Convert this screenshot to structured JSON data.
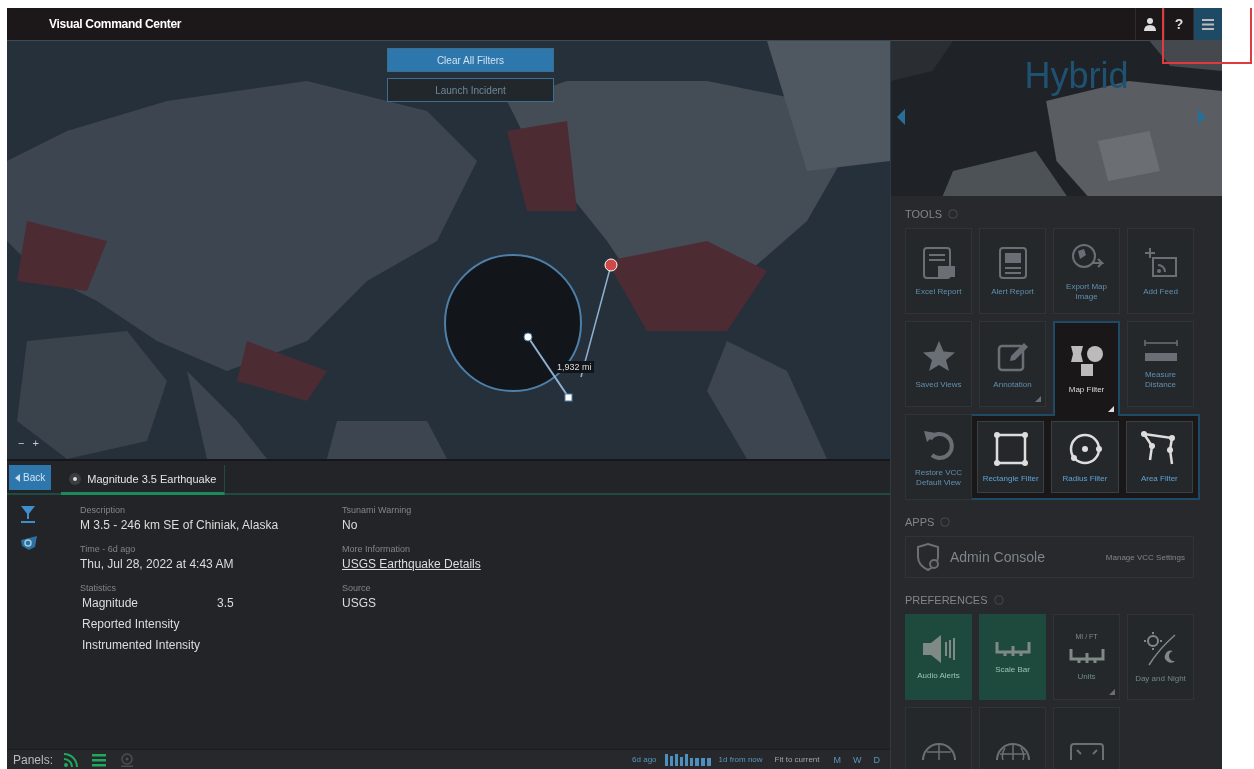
{
  "window": {
    "title": "Visual Command Center"
  },
  "header_buttons": [
    {
      "kind": "user",
      "selected": false
    },
    {
      "kind": "help",
      "label": "?",
      "selected": false
    },
    {
      "kind": "menu",
      "selected": true
    }
  ],
  "highlight_box": true,
  "map": {
    "buttons": [
      {
        "kind": "primary",
        "label": "Clear All Filters"
      },
      {
        "kind": "outline",
        "label": "Launch Incident"
      }
    ],
    "radius_label": "1,932 mi",
    "zoom": [
      {
        "label": "−"
      },
      {
        "label": "+"
      }
    ]
  },
  "detail": {
    "back": "Back",
    "tabs": [
      {
        "label": "Magnitude 3.5 Earthquake",
        "selected": true
      }
    ],
    "columns": [
      [
        {
          "kind": "text",
          "label": "Description",
          "value": "M 3.5 - 246 km SE of Chiniak, Alaska"
        },
        {
          "kind": "text",
          "label": "Time - 6d ago",
          "value": "Thu, Jul 28, 2022 at 4:43 AM"
        },
        {
          "kind": "table",
          "label": "Statistics",
          "rows": [
            {
              "name": "Magnitude",
              "value": "3.5"
            },
            {
              "name": "Reported Intensity"
            },
            {
              "name": "Instrumented Intensity"
            }
          ]
        }
      ],
      [
        {
          "kind": "text",
          "label": "Tsunami Warning",
          "value": "No"
        },
        {
          "kind": "link",
          "label": "More Information",
          "value": "USGS Earthquake Details"
        },
        {
          "kind": "text",
          "label": "Source",
          "value": "USGS"
        }
      ]
    ]
  },
  "status_bar": {
    "label": "Panels:",
    "panels": [
      {
        "kind": "feed",
        "on": true
      },
      {
        "kind": "list",
        "on": true
      },
      {
        "kind": "pin",
        "on": false
      }
    ],
    "timeline": {
      "start": "6d ago",
      "end": "1d from now"
    },
    "fit": "Fit to current",
    "ranges": [
      {
        "label": "M"
      },
      {
        "label": "W"
      },
      {
        "label": "D"
      }
    ]
  },
  "side": {
    "basemap": "Hybrid",
    "tools_heading": "TOOLS",
    "tools": [
      {
        "kind": "excel",
        "label": "Excel Report",
        "selected": false,
        "has_menu": false
      },
      {
        "kind": "alert",
        "label": "Alert Report",
        "selected": false,
        "has_menu": false
      },
      {
        "kind": "export",
        "label": "Export Map Image",
        "selected": false,
        "has_menu": false
      },
      {
        "kind": "feed",
        "label": "Add Feed",
        "selected": false,
        "has_menu": false
      },
      {
        "kind": "star",
        "label": "Saved Views",
        "selected": false,
        "has_menu": false
      },
      {
        "kind": "annotation",
        "label": "Annotation",
        "selected": false,
        "has_menu": true
      },
      {
        "kind": "filter",
        "label": "Map Filter",
        "selected": true,
        "has_menu": true
      },
      {
        "kind": "measure",
        "label": "Measure Distance",
        "selected": false,
        "has_menu": false
      },
      {
        "kind": "restore",
        "label": "Restore VCC Default View",
        "selected": false,
        "has_menu": false
      }
    ],
    "filter_menu": [
      {
        "kind": "rectangle",
        "label": "Rectangle Filter"
      },
      {
        "kind": "radius",
        "label": "Radius Filter"
      },
      {
        "kind": "area",
        "label": "Area Filter"
      }
    ],
    "apps_heading": "APPS",
    "apps": [
      {
        "label": "Admin Console",
        "action": "Manage VCC Settings"
      }
    ],
    "preferences_heading": "PREFERENCES",
    "preferences": [
      {
        "kind": "audio",
        "label": "Audio Alerts",
        "on": true,
        "has_menu": false
      },
      {
        "kind": "scale",
        "label": "Scale Bar",
        "on": true,
        "has_menu": false
      },
      {
        "kind": "units",
        "caption": "MI / FT",
        "label": "Units",
        "on": false,
        "has_menu": true
      },
      {
        "kind": "daynight",
        "label": "Day and Night",
        "on": false,
        "has_menu": false
      },
      {
        "kind": "globe",
        "on": false
      },
      {
        "kind": "grid-globe",
        "on": false
      },
      {
        "kind": "fullscreen",
        "on": false
      }
    ]
  }
}
